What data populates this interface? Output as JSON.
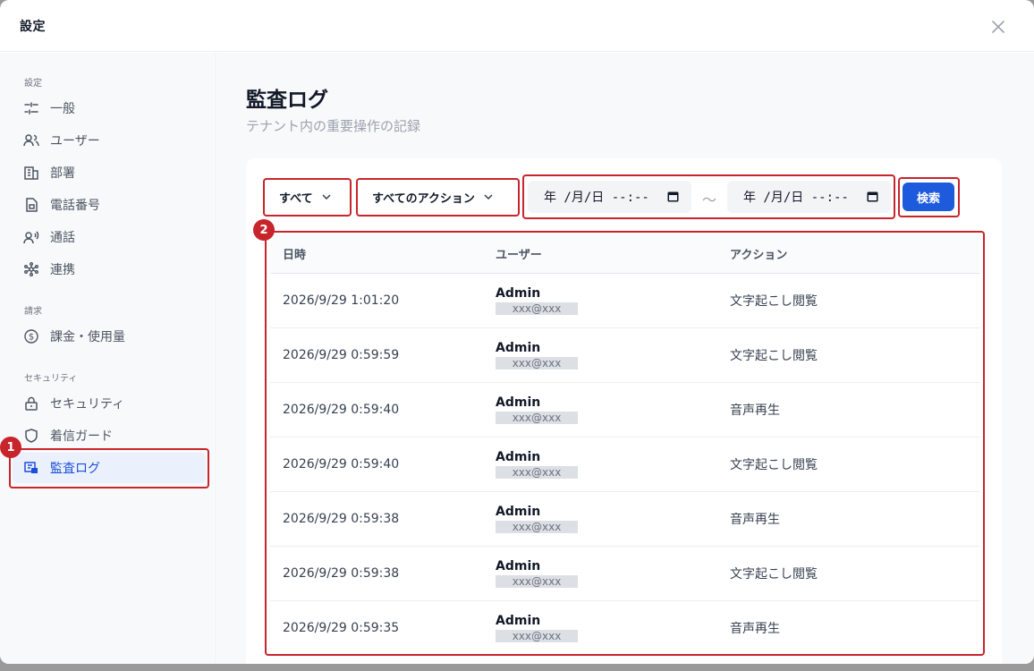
{
  "modal": {
    "title": "設定",
    "close_icon": "close-icon"
  },
  "sidebar": {
    "sections": [
      {
        "label": "設定",
        "items": [
          {
            "label": "一般",
            "icon": "sliders-icon"
          },
          {
            "label": "ユーザー",
            "icon": "users-icon"
          },
          {
            "label": "部署",
            "icon": "building-icon"
          },
          {
            "label": "電話番号",
            "icon": "sim-card-icon"
          },
          {
            "label": "通話",
            "icon": "voice-icon"
          },
          {
            "label": "連携",
            "icon": "network-icon"
          }
        ]
      },
      {
        "label": "請求",
        "items": [
          {
            "label": "課金・使用量",
            "icon": "dollar-icon"
          }
        ]
      },
      {
        "label": "セキュリティ",
        "items": [
          {
            "label": "セキュリティ",
            "icon": "lock-icon"
          },
          {
            "label": "着信ガード",
            "icon": "shield-icon"
          },
          {
            "label": "監査ログ",
            "icon": "audit-log-icon",
            "active": true
          }
        ]
      }
    ]
  },
  "page": {
    "title": "監査ログ",
    "subtitle": "テナント内の重要操作の記録"
  },
  "filters": {
    "user_select": "すべて",
    "action_select": "すべてのアクション",
    "date_from": "年 /月/日 --:--",
    "date_to": "年 /月/日 --:--",
    "separator": "～",
    "search_label": "検索"
  },
  "annotations": {
    "badge1": "1",
    "badge2": "2"
  },
  "table": {
    "headers": {
      "datetime": "日時",
      "user": "ユーザー",
      "action": "アクション"
    },
    "rows": [
      {
        "datetime": "2026/9/29 1:01:20",
        "user": "Admin",
        "email": "xxx@xxx",
        "action": "文字起こし閲覧"
      },
      {
        "datetime": "2026/9/29 0:59:59",
        "user": "Admin",
        "email": "xxx@xxx",
        "action": "文字起こし閲覧"
      },
      {
        "datetime": "2026/9/29 0:59:40",
        "user": "Admin",
        "email": "xxx@xxx",
        "action": "音声再生"
      },
      {
        "datetime": "2026/9/29 0:59:40",
        "user": "Admin",
        "email": "xxx@xxx",
        "action": "文字起こし閲覧"
      },
      {
        "datetime": "2026/9/29 0:59:38",
        "user": "Admin",
        "email": "xxx@xxx",
        "action": "音声再生"
      },
      {
        "datetime": "2026/9/29 0:59:38",
        "user": "Admin",
        "email": "xxx@xxx",
        "action": "文字起こし閲覧"
      },
      {
        "datetime": "2026/9/29 0:59:35",
        "user": "Admin",
        "email": "xxx@xxx",
        "action": "音声再生"
      }
    ]
  },
  "colors": {
    "accent": "#1d5bdc",
    "highlight": "#c8242c",
    "active_bg": "#eaf1fd"
  }
}
